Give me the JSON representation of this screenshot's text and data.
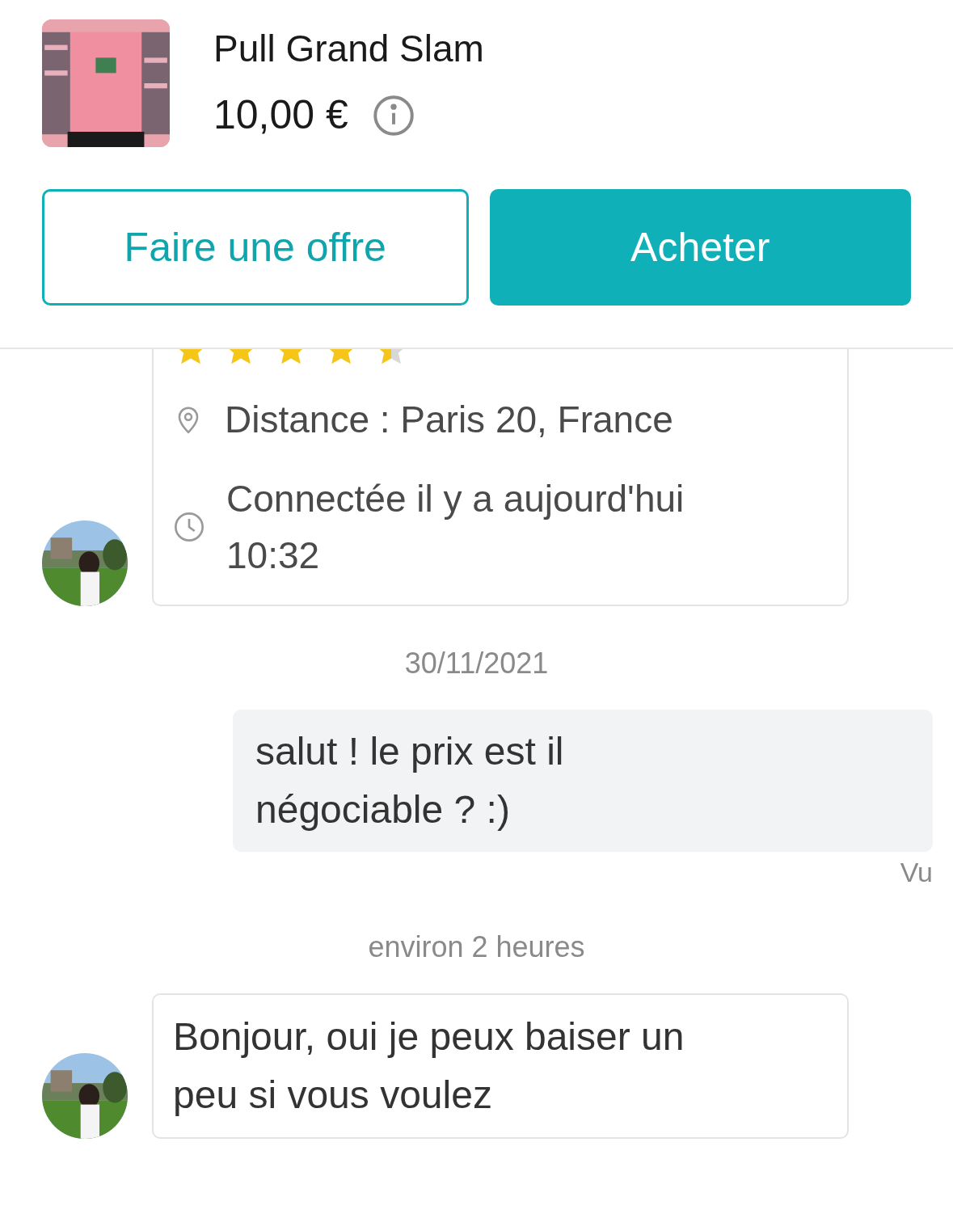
{
  "item": {
    "title": "Pull Grand Slam",
    "price": "10,00 €"
  },
  "actions": [
    {
      "label": "Faire une offre",
      "kind": "outline"
    },
    {
      "label": "Acheter",
      "kind": "solid"
    }
  ],
  "profile_card": {
    "stars": 4.5,
    "details": [
      {
        "kind": "location",
        "text": "Distance : Paris 20, France"
      },
      {
        "kind": "clock",
        "text": "Connectée il y a aujourd'hui 10:32"
      }
    ]
  },
  "messages": [
    {
      "kind": "date",
      "text": "30/11/2021"
    },
    {
      "kind": "outgoing",
      "text": "salut ! le prix est il négociable ? :)",
      "status": "Vu"
    },
    {
      "kind": "date",
      "text": "environ 2 heures"
    },
    {
      "kind": "incoming",
      "text": "Bonjour, oui je peux baiser un peu si vous voulez"
    }
  ]
}
